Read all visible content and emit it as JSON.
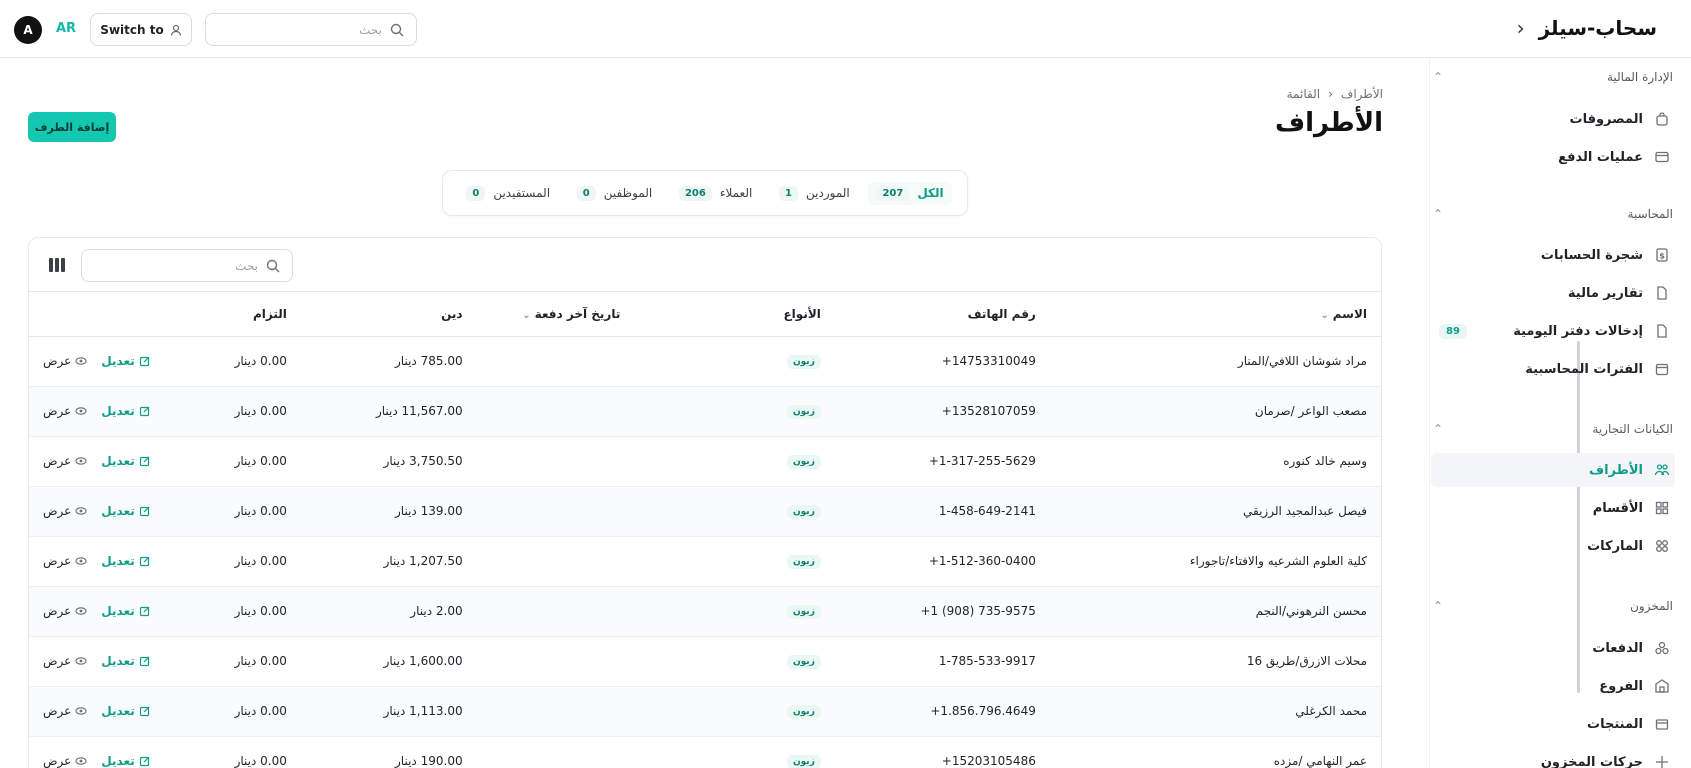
{
  "header": {
    "brand_title": "سحاب-سيلز",
    "search_placeholder": "بحث",
    "switch_label": "Switch to",
    "lang": "AR",
    "avatar_initial": "A"
  },
  "sidebar": {
    "sections": [
      {
        "label": "الإدارة المالية",
        "items": [
          {
            "label": "المصروفات",
            "icon": "bag-icon"
          },
          {
            "label": "عمليات الدفع",
            "icon": "card-icon"
          }
        ]
      },
      {
        "label": "المحاسبة",
        "items": [
          {
            "label": "شجرة الحسابات",
            "icon": "dollar-file-icon"
          },
          {
            "label": "تقارير مالية",
            "icon": "file-icon"
          },
          {
            "label": "إدخالات دفتر اليومية",
            "icon": "file-icon",
            "badge": "89"
          },
          {
            "label": "الفترات المحاسبية",
            "icon": "calendar-icon"
          }
        ]
      },
      {
        "label": "الكيانات التجارية",
        "items": [
          {
            "label": "الأطراف",
            "icon": "people-icon",
            "active": true
          },
          {
            "label": "الأقسام",
            "icon": "grid-icon"
          },
          {
            "label": "الماركات",
            "icon": "circles-icon"
          }
        ]
      },
      {
        "label": "المخزون",
        "items": [
          {
            "label": "الدفعات",
            "icon": "boxes-icon"
          },
          {
            "label": "الفروع",
            "icon": "store-icon"
          },
          {
            "label": "المنتجات",
            "icon": "product-icon"
          },
          {
            "label": "حركات المخزون",
            "icon": "move-icon"
          }
        ]
      }
    ]
  },
  "page": {
    "breadcrumb_parent": "الأطراف",
    "breadcrumb_current": "القائمة",
    "title": "الأطراف",
    "add_button": "إضافة الطرف"
  },
  "filters": [
    {
      "label": "الكل",
      "count": "207",
      "active": true
    },
    {
      "label": "الموردين",
      "count": "1"
    },
    {
      "label": "العملاء",
      "count": "206"
    },
    {
      "label": "الموظفين",
      "count": "0"
    },
    {
      "label": "المستفيدين",
      "count": "0"
    }
  ],
  "table": {
    "search_placeholder": "بحث",
    "columns": [
      "الاسم",
      "رقم الهاتف",
      "الأنواع",
      "تاريخ آخر دفعة",
      "دين",
      "التزام"
    ],
    "edit_label": "تعديل",
    "view_label": "عرض",
    "rows": [
      {
        "name": "مراد شوشان اللافي/المنار",
        "phone": "+14753310049",
        "type": "زبون",
        "last_payment": "",
        "debt": "785.00 دينار",
        "obligation": "0.00 دينار"
      },
      {
        "name": "مصعب الواعر /صرمان",
        "phone": "+13528107059",
        "type": "زبون",
        "last_payment": "",
        "debt": "11,567.00 دينار",
        "obligation": "0.00 دينار"
      },
      {
        "name": "وسيم خالد كنوره",
        "phone": "+1-317-255-5629",
        "type": "زبون",
        "last_payment": "",
        "debt": "3,750.50 دينار",
        "obligation": "0.00 دينار"
      },
      {
        "name": "فيصل عبدالمجيد الرزيقي",
        "phone": "1-458-649-2141",
        "type": "زبون",
        "last_payment": "",
        "debt": "139.00 دينار",
        "obligation": "0.00 دينار"
      },
      {
        "name": "كلية العلوم الشرعيه والافتاء/تاجوراء",
        "phone": "+1-512-360-0400",
        "type": "زبون",
        "last_payment": "",
        "debt": "1,207.50 دينار",
        "obligation": "0.00 دينار"
      },
      {
        "name": "محسن النرهوني/النجم",
        "phone": "+1 (908) 735-9575",
        "type": "زبون",
        "last_payment": "",
        "debt": "2.00 دينار",
        "obligation": "0.00 دينار"
      },
      {
        "name": "محلات الازرق/طريق 16",
        "phone": "1-785-533-9917",
        "type": "زبون",
        "last_payment": "",
        "debt": "1,600.00 دينار",
        "obligation": "0.00 دينار"
      },
      {
        "name": "محمد الكرغلي",
        "phone": "+1.856.796.4649",
        "type": "زبون",
        "last_payment": "",
        "debt": "1,113.00 دينار",
        "obligation": "0.00 دينار"
      },
      {
        "name": "عمر النهامي /مزده",
        "phone": "+15203105486",
        "type": "زبون",
        "last_payment": "",
        "debt": "190.00 دينار",
        "obligation": "0.00 دينار"
      }
    ]
  }
}
